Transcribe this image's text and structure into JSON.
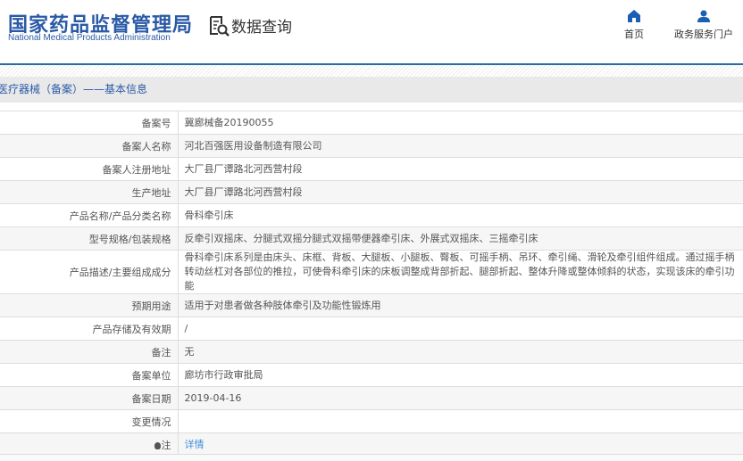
{
  "header": {
    "logo_cn": "国家药品监督管理局",
    "logo_en": "National Medical Products Administration",
    "section": "数据查询",
    "nav": [
      {
        "label": "首页",
        "icon": "home-icon"
      },
      {
        "label": "政务服务门户",
        "icon": "user-icon"
      }
    ]
  },
  "title": "医疗器械（备案）——基本信息",
  "rows": [
    {
      "label": "备案号",
      "value": "冀廊械备20190055"
    },
    {
      "label": "备案人名称",
      "value": "河北百强医用设备制造有限公司"
    },
    {
      "label": "备案人注册地址",
      "value": "大厂县厂谭路北河西营村段"
    },
    {
      "label": "生产地址",
      "value": "大厂县厂谭路北河西营村段"
    },
    {
      "label": "产品名称/产品分类名称",
      "value": "骨科牵引床"
    },
    {
      "label": "型号规格/包装规格",
      "value": "反牵引双摇床、分腿式双摇分腿式双摇带便器牵引床、外展式双摇床、三摇牵引床"
    },
    {
      "label": "产品描述/主要组成成分",
      "value": "骨科牵引床系列是由床头、床框、背板、大腿板、小腿板、臀板、可摇手柄、吊环、牵引绳、滑轮及牵引组件组成。通过摇手柄转动丝杠对各部位的推拉，可使骨科牵引床的床板调整成背部折起、腿部折起、整体升降或整体倾斜的状态，实现该床的牵引功能"
    },
    {
      "label": "预期用途",
      "value": "适用于对患者做各种肢体牵引及功能性锻炼用"
    },
    {
      "label": "产品存储及有效期",
      "value": "/"
    },
    {
      "label": "备注",
      "value": "无"
    },
    {
      "label": "备案单位",
      "value": "廊坊市行政审批局"
    },
    {
      "label": "备案日期",
      "value": "2019-04-16"
    },
    {
      "label": "变更情况",
      "value": ""
    },
    {
      "label": "注",
      "value": "详情"
    }
  ]
}
